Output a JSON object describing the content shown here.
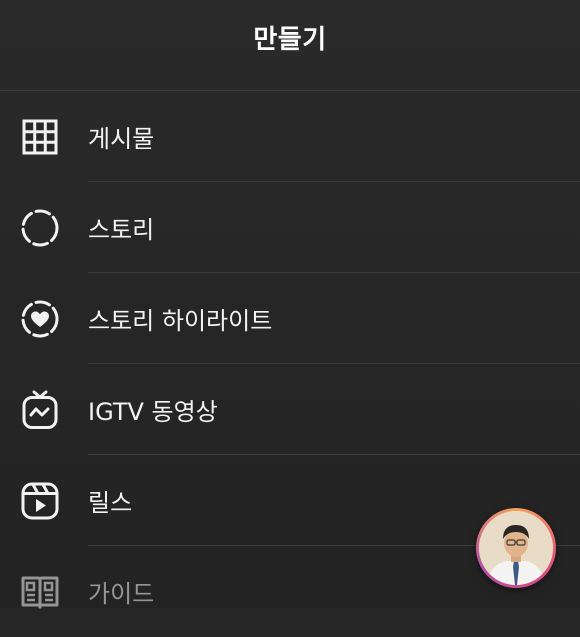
{
  "header": {
    "title": "만들기"
  },
  "menu": {
    "items": [
      {
        "label": "게시물",
        "icon": "grid-icon"
      },
      {
        "label": "스토리",
        "icon": "story-dashed-circle-icon"
      },
      {
        "label": "스토리 하이라이트",
        "icon": "highlight-heart-icon"
      },
      {
        "label": "IGTV 동영상",
        "icon": "igtv-icon"
      },
      {
        "label": "릴스",
        "icon": "reels-icon"
      },
      {
        "label": "가이드",
        "icon": "guide-book-icon"
      }
    ]
  },
  "floating_avatar": {
    "icon": "profile-avatar"
  },
  "colors": {
    "background": "#262626",
    "text": "#f5f5f5",
    "divider": "#3a3a3a"
  }
}
